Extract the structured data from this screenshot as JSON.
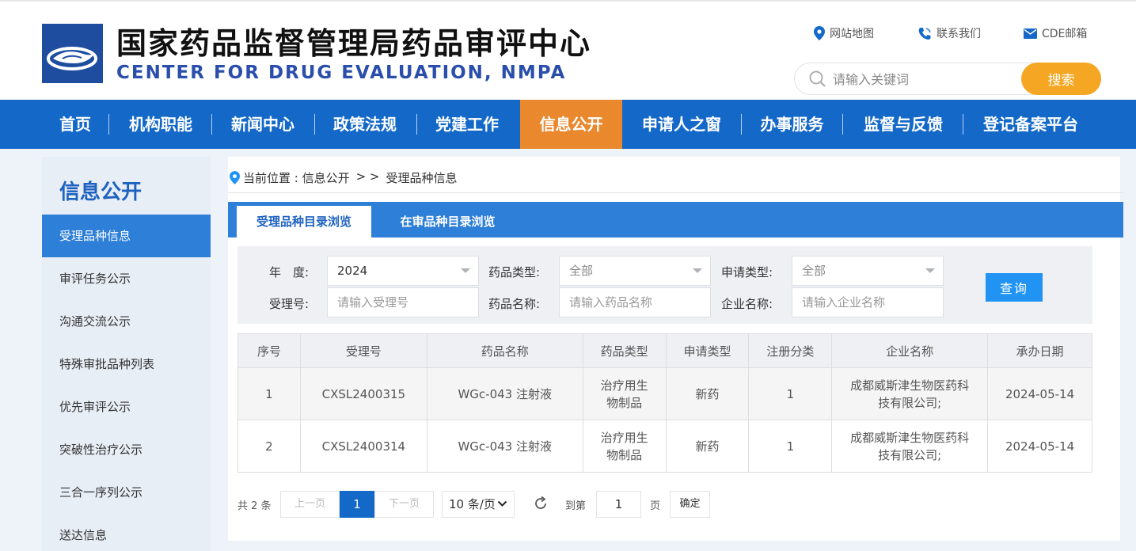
{
  "header": {
    "title_cn": "国家药品监督管理局药品审评中心",
    "title_en": "CENTER FOR DRUG EVALUATION, NMPA",
    "links": {
      "sitemap": "网站地图",
      "contact": "联系我们",
      "mail": "CDE邮箱"
    },
    "search": {
      "placeholder": "请输入关键词",
      "button": "搜索"
    }
  },
  "nav": {
    "items": [
      "首页",
      "机构职能",
      "新闻中心",
      "政策法规",
      "党建工作",
      "信息公开",
      "申请人之窗",
      "办事服务",
      "监督与反馈",
      "登记备案平台"
    ],
    "active_index": 5,
    "active_color": "#e9882d",
    "bar_color": "#1468c8"
  },
  "sidebar": {
    "title": "信息公开",
    "items": [
      "受理品种信息",
      "审评任务公示",
      "沟通交流公示",
      "特殊审批品种列表",
      "优先审评公示",
      "突破性治疗公示",
      "三合一序列公示",
      "送达信息"
    ],
    "active_index": 0
  },
  "breadcrumb": {
    "prefix": "当前位置 : 信息公开",
    "sep": "> >",
    "current": "受理品种信息"
  },
  "tabs": [
    "受理品种目录浏览",
    "在审品种目录浏览"
  ],
  "filters": {
    "year_label": "年　度:",
    "year_value": "2024",
    "drug_type_label": "药品类型:",
    "drug_type_value": "全部",
    "apply_type_label": "申请类型:",
    "apply_type_value": "全部",
    "accept_no_label": "受理号:",
    "accept_no_placeholder": "请输入受理号",
    "drug_name_label": "药品名称:",
    "drug_name_placeholder": "请输入药品名称",
    "company_label": "企业名称:",
    "company_placeholder": "请输入企业名称",
    "query_button": "查询"
  },
  "table": {
    "columns": [
      "序号",
      "受理号",
      "药品名称",
      "药品类型",
      "申请类型",
      "注册分类",
      "企业名称",
      "承办日期"
    ],
    "rows": [
      {
        "no": "1",
        "accept_no": "CXSL2400315",
        "drug_name": "WGc-043 注射液",
        "drug_type": "治疗用生物制品",
        "apply_type": "新药",
        "reg_class": "1",
        "company": "成都威斯津生物医药科技有限公司;",
        "date": "2024-05-14"
      },
      {
        "no": "2",
        "accept_no": "CXSL2400314",
        "drug_name": "WGc-043 注射液",
        "drug_type": "治疗用生物制品",
        "apply_type": "新药",
        "reg_class": "1",
        "company": "成都威斯津生物医药科技有限公司;",
        "date": "2024-05-14"
      }
    ]
  },
  "pagination": {
    "total": "共 2 条",
    "prev": "上一页",
    "current": "1",
    "next": "下一页",
    "page_size": "10 条/页",
    "goto_label": "到第",
    "goto_value": "1",
    "page_label": "页",
    "confirm": "确定"
  }
}
